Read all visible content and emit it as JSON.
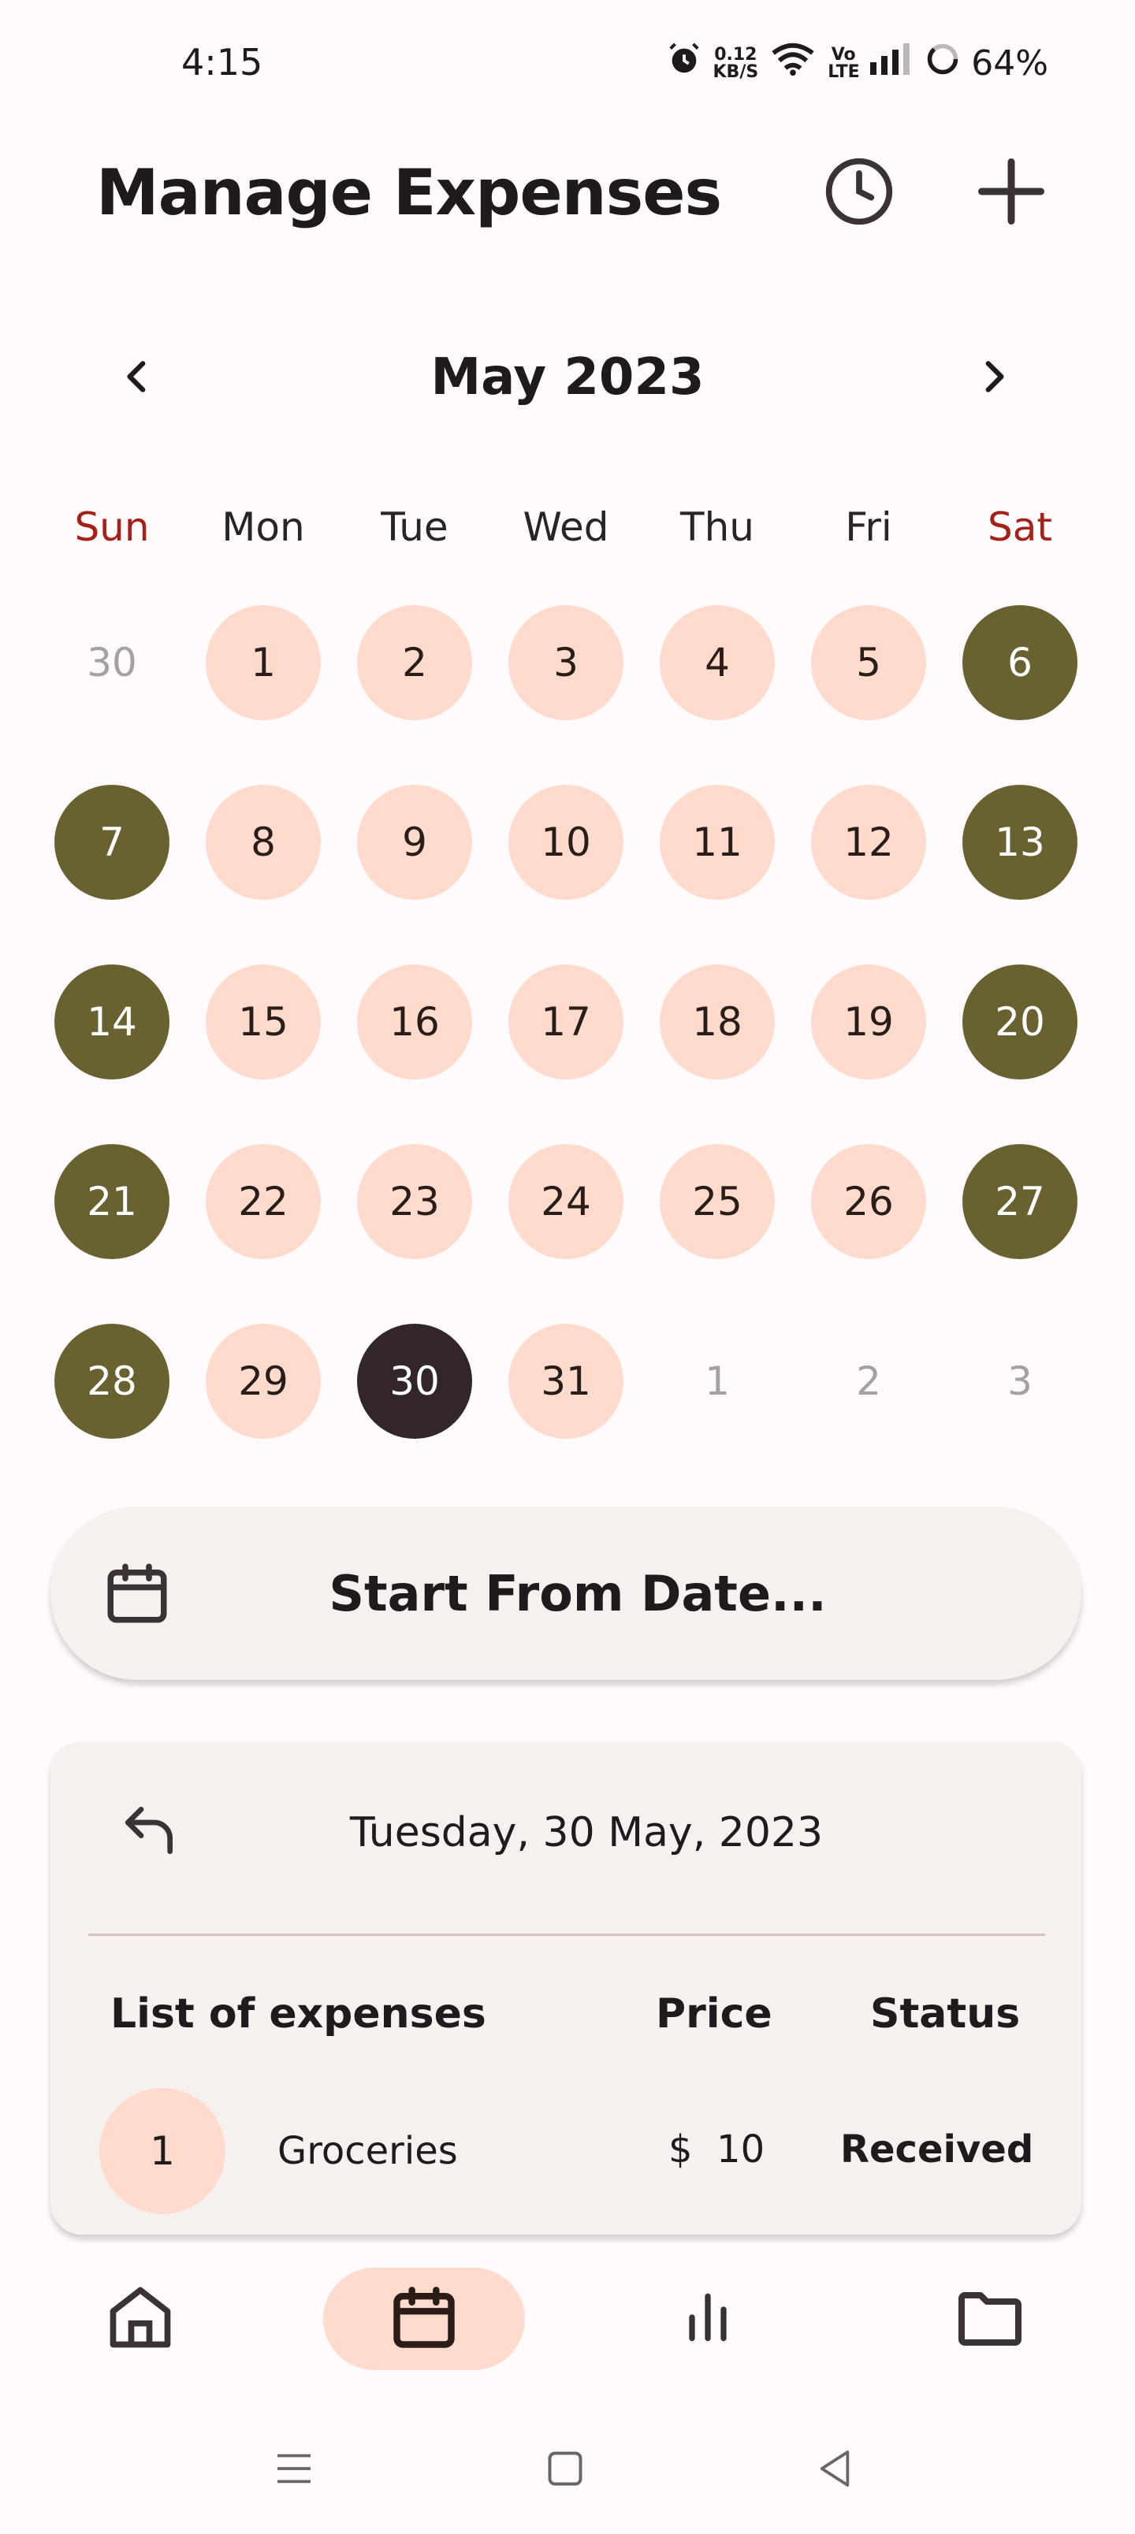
{
  "status_bar": {
    "time": "4:15",
    "net_speed_value": "0.12",
    "net_speed_unit": "KB/S",
    "network_label": "Vo LTE",
    "battery": "64%"
  },
  "app_bar": {
    "title": "Manage Expenses",
    "history_icon": "clock-icon",
    "add_icon": "plus-icon"
  },
  "calendar": {
    "month_label": "May 2023",
    "weekdays": [
      "Sun",
      "Mon",
      "Tue",
      "Wed",
      "Thu",
      "Fri",
      "Sat"
    ],
    "weeks": [
      [
        {
          "d": "30",
          "t": "muted"
        },
        {
          "d": "1",
          "t": "regular"
        },
        {
          "d": "2",
          "t": "regular"
        },
        {
          "d": "3",
          "t": "regular"
        },
        {
          "d": "4",
          "t": "regular"
        },
        {
          "d": "5",
          "t": "regular"
        },
        {
          "d": "6",
          "t": "weekend"
        }
      ],
      [
        {
          "d": "7",
          "t": "weekend"
        },
        {
          "d": "8",
          "t": "regular"
        },
        {
          "d": "9",
          "t": "regular"
        },
        {
          "d": "10",
          "t": "regular"
        },
        {
          "d": "11",
          "t": "regular"
        },
        {
          "d": "12",
          "t": "regular"
        },
        {
          "d": "13",
          "t": "weekend"
        }
      ],
      [
        {
          "d": "14",
          "t": "weekend"
        },
        {
          "d": "15",
          "t": "regular"
        },
        {
          "d": "16",
          "t": "regular"
        },
        {
          "d": "17",
          "t": "regular"
        },
        {
          "d": "18",
          "t": "regular"
        },
        {
          "d": "19",
          "t": "regular"
        },
        {
          "d": "20",
          "t": "weekend"
        }
      ],
      [
        {
          "d": "21",
          "t": "weekend"
        },
        {
          "d": "22",
          "t": "regular"
        },
        {
          "d": "23",
          "t": "regular"
        },
        {
          "d": "24",
          "t": "regular"
        },
        {
          "d": "25",
          "t": "regular"
        },
        {
          "d": "26",
          "t": "regular"
        },
        {
          "d": "27",
          "t": "weekend"
        }
      ],
      [
        {
          "d": "28",
          "t": "weekend"
        },
        {
          "d": "29",
          "t": "regular"
        },
        {
          "d": "30",
          "t": "selected"
        },
        {
          "d": "31",
          "t": "regular"
        },
        {
          "d": "1",
          "t": "muted"
        },
        {
          "d": "2",
          "t": "muted"
        },
        {
          "d": "3",
          "t": "muted"
        }
      ]
    ]
  },
  "start_button": {
    "label": "Start From Date...",
    "icon": "calendar-icon"
  },
  "day_card": {
    "date": "Tuesday, 30 May, 2023",
    "back_icon": "undo-arrow-icon",
    "columns": {
      "list": "List of expenses",
      "price": "Price",
      "status": "Status"
    },
    "expenses": [
      {
        "num": "1",
        "name": "Groceries",
        "price": "$  10",
        "status": "Received"
      }
    ]
  },
  "bottom_nav": {
    "items": [
      {
        "name": "home",
        "icon": "home-icon"
      },
      {
        "name": "calendar",
        "icon": "calendar-icon",
        "active": true
      },
      {
        "name": "stats",
        "icon": "bar-chart-icon"
      },
      {
        "name": "files",
        "icon": "folder-icon"
      }
    ]
  },
  "colors": {
    "background": "#fffbfd",
    "day_regular": "#ffdbcd",
    "day_weekend": "#696230",
    "day_selected": "#322628",
    "weekend_label": "#a3201b",
    "card": "#f6f0ef"
  }
}
